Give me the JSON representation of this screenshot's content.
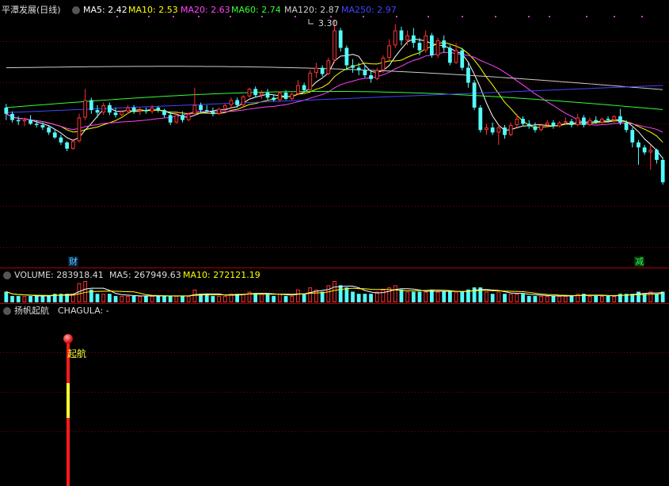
{
  "main_panel": {
    "title": "平潭发展(日线)",
    "ma": [
      {
        "label": "MA5: 2.42",
        "color": "#ffffff"
      },
      {
        "label": "MA10: 2.53",
        "color": "#ffff00"
      },
      {
        "label": "MA20: 2.63",
        "color": "#ff44ff"
      },
      {
        "label": "MA60: 2.74",
        "color": "#33ff33"
      },
      {
        "label": "MA120: 2.87",
        "color": "#cccccc"
      },
      {
        "label": "MA250: 2.97",
        "color": "#4444ff"
      }
    ],
    "high_marker": "3.30",
    "markers": [
      {
        "text": "财",
        "color": "#66ccff"
      },
      {
        "text": "减",
        "color": "#33ff66"
      }
    ]
  },
  "volume_panel": {
    "title": "VOLUME: 283918.41",
    "ma5": "MA5: 267949.63",
    "ma10": "MA10: 272121.19"
  },
  "indicator_panel": {
    "title": "扬帆起航",
    "chagula": "CHAGULA: -",
    "signal_label": "起航"
  },
  "colors": {
    "up": "#ff3232",
    "down": "#54fcfc",
    "grid": "#8b0000",
    "border": "#b00000"
  },
  "chart_data": {
    "type": "candlestick",
    "price_range": [
      1.9,
      3.35
    ],
    "volume_unit": "relative",
    "candles": [
      {
        "o": 2.6,
        "h": 2.63,
        "l": 2.5,
        "c": 2.55,
        "v": 0.5
      },
      {
        "o": 2.55,
        "h": 2.57,
        "l": 2.48,
        "c": 2.5,
        "v": 0.3
      },
      {
        "o": 2.5,
        "h": 2.53,
        "l": 2.46,
        "c": 2.49,
        "v": 0.3
      },
      {
        "o": 2.49,
        "h": 2.52,
        "l": 2.45,
        "c": 2.5,
        "v": 0.3
      },
      {
        "o": 2.5,
        "h": 2.54,
        "l": 2.46,
        "c": 2.47,
        "v": 0.3
      },
      {
        "o": 2.47,
        "h": 2.5,
        "l": 2.44,
        "c": 2.46,
        "v": 0.3
      },
      {
        "o": 2.46,
        "h": 2.48,
        "l": 2.42,
        "c": 2.44,
        "v": 0.3
      },
      {
        "o": 2.44,
        "h": 2.46,
        "l": 2.38,
        "c": 2.4,
        "v": 0.3
      },
      {
        "o": 2.4,
        "h": 2.42,
        "l": 2.35,
        "c": 2.36,
        "v": 0.4
      },
      {
        "o": 2.36,
        "h": 2.38,
        "l": 2.3,
        "c": 2.32,
        "v": 0.4
      },
      {
        "o": 2.32,
        "h": 2.33,
        "l": 2.25,
        "c": 2.27,
        "v": 0.4
      },
      {
        "o": 2.27,
        "h": 2.35,
        "l": 2.26,
        "c": 2.33,
        "v": 0.4
      },
      {
        "o": 2.33,
        "h": 2.55,
        "l": 2.32,
        "c": 2.52,
        "v": 0.9
      },
      {
        "o": 2.52,
        "h": 2.75,
        "l": 2.5,
        "c": 2.66,
        "v": 1.0
      },
      {
        "o": 2.66,
        "h": 2.68,
        "l": 2.55,
        "c": 2.58,
        "v": 0.6
      },
      {
        "o": 2.58,
        "h": 2.62,
        "l": 2.52,
        "c": 2.56,
        "v": 0.4
      },
      {
        "o": 2.56,
        "h": 2.64,
        "l": 2.54,
        "c": 2.62,
        "v": 0.4
      },
      {
        "o": 2.62,
        "h": 2.64,
        "l": 2.54,
        "c": 2.56,
        "v": 0.4
      },
      {
        "o": 2.56,
        "h": 2.6,
        "l": 2.52,
        "c": 2.54,
        "v": 0.3
      },
      {
        "o": 2.54,
        "h": 2.58,
        "l": 2.53,
        "c": 2.57,
        "v": 0.3
      },
      {
        "o": 2.57,
        "h": 2.62,
        "l": 2.55,
        "c": 2.6,
        "v": 0.3
      },
      {
        "o": 2.6,
        "h": 2.62,
        "l": 2.55,
        "c": 2.57,
        "v": 0.3
      },
      {
        "o": 2.57,
        "h": 2.6,
        "l": 2.54,
        "c": 2.58,
        "v": 0.3
      },
      {
        "o": 2.58,
        "h": 2.6,
        "l": 2.55,
        "c": 2.57,
        "v": 0.3
      },
      {
        "o": 2.57,
        "h": 2.62,
        "l": 2.55,
        "c": 2.6,
        "v": 0.3
      },
      {
        "o": 2.6,
        "h": 2.61,
        "l": 2.56,
        "c": 2.58,
        "v": 0.3
      },
      {
        "o": 2.58,
        "h": 2.59,
        "l": 2.52,
        "c": 2.54,
        "v": 0.3
      },
      {
        "o": 2.54,
        "h": 2.57,
        "l": 2.46,
        "c": 2.48,
        "v": 0.3
      },
      {
        "o": 2.48,
        "h": 2.56,
        "l": 2.47,
        "c": 2.54,
        "v": 0.3
      },
      {
        "o": 2.54,
        "h": 2.57,
        "l": 2.48,
        "c": 2.5,
        "v": 0.3
      },
      {
        "o": 2.5,
        "h": 2.56,
        "l": 2.49,
        "c": 2.55,
        "v": 0.3
      },
      {
        "o": 2.55,
        "h": 2.76,
        "l": 2.54,
        "c": 2.62,
        "v": 0.6
      },
      {
        "o": 2.62,
        "h": 2.64,
        "l": 2.55,
        "c": 2.58,
        "v": 0.4
      },
      {
        "o": 2.58,
        "h": 2.62,
        "l": 2.55,
        "c": 2.57,
        "v": 0.4
      },
      {
        "o": 2.57,
        "h": 2.6,
        "l": 2.53,
        "c": 2.55,
        "v": 0.3
      },
      {
        "o": 2.55,
        "h": 2.6,
        "l": 2.54,
        "c": 2.59,
        "v": 0.3
      },
      {
        "o": 2.59,
        "h": 2.63,
        "l": 2.57,
        "c": 2.62,
        "v": 0.3
      },
      {
        "o": 2.62,
        "h": 2.68,
        "l": 2.6,
        "c": 2.66,
        "v": 0.4
      },
      {
        "o": 2.66,
        "h": 2.68,
        "l": 2.6,
        "c": 2.62,
        "v": 0.4
      },
      {
        "o": 2.62,
        "h": 2.7,
        "l": 2.61,
        "c": 2.69,
        "v": 0.4
      },
      {
        "o": 2.69,
        "h": 2.76,
        "l": 2.68,
        "c": 2.75,
        "v": 0.5
      },
      {
        "o": 2.75,
        "h": 2.77,
        "l": 2.68,
        "c": 2.7,
        "v": 0.4
      },
      {
        "o": 2.7,
        "h": 2.74,
        "l": 2.67,
        "c": 2.72,
        "v": 0.4
      },
      {
        "o": 2.72,
        "h": 2.75,
        "l": 2.66,
        "c": 2.68,
        "v": 0.4
      },
      {
        "o": 2.68,
        "h": 2.7,
        "l": 2.65,
        "c": 2.66,
        "v": 0.3
      },
      {
        "o": 2.66,
        "h": 2.73,
        "l": 2.65,
        "c": 2.72,
        "v": 0.4
      },
      {
        "o": 2.72,
        "h": 2.74,
        "l": 2.66,
        "c": 2.67,
        "v": 0.3
      },
      {
        "o": 2.67,
        "h": 2.72,
        "l": 2.66,
        "c": 2.71,
        "v": 0.3
      },
      {
        "o": 2.71,
        "h": 2.82,
        "l": 2.7,
        "c": 2.78,
        "v": 0.6
      },
      {
        "o": 2.78,
        "h": 2.8,
        "l": 2.72,
        "c": 2.74,
        "v": 0.4
      },
      {
        "o": 2.74,
        "h": 2.9,
        "l": 2.73,
        "c": 2.88,
        "v": 0.7
      },
      {
        "o": 2.88,
        "h": 2.96,
        "l": 2.84,
        "c": 2.92,
        "v": 0.6
      },
      {
        "o": 2.92,
        "h": 2.94,
        "l": 2.85,
        "c": 2.87,
        "v": 0.5
      },
      {
        "o": 2.87,
        "h": 3.0,
        "l": 2.86,
        "c": 2.98,
        "v": 0.8
      },
      {
        "o": 2.98,
        "h": 3.3,
        "l": 2.96,
        "c": 3.22,
        "v": 1.0
      },
      {
        "o": 3.22,
        "h": 3.24,
        "l": 3.05,
        "c": 3.08,
        "v": 0.8
      },
      {
        "o": 3.08,
        "h": 3.1,
        "l": 2.9,
        "c": 2.94,
        "v": 0.7
      },
      {
        "o": 2.94,
        "h": 2.99,
        "l": 2.88,
        "c": 2.92,
        "v": 0.5
      },
      {
        "o": 2.92,
        "h": 2.96,
        "l": 2.86,
        "c": 2.9,
        "v": 0.4
      },
      {
        "o": 2.9,
        "h": 2.94,
        "l": 2.84,
        "c": 2.86,
        "v": 0.4
      },
      {
        "o": 2.86,
        "h": 2.9,
        "l": 2.8,
        "c": 2.83,
        "v": 0.4
      },
      {
        "o": 2.83,
        "h": 2.92,
        "l": 2.82,
        "c": 2.9,
        "v": 0.5
      },
      {
        "o": 2.9,
        "h": 3.02,
        "l": 2.88,
        "c": 3.0,
        "v": 0.6
      },
      {
        "o": 3.0,
        "h": 3.15,
        "l": 2.98,
        "c": 3.1,
        "v": 0.7
      },
      {
        "o": 3.1,
        "h": 3.27,
        "l": 3.08,
        "c": 3.22,
        "v": 0.8
      },
      {
        "o": 3.22,
        "h": 3.25,
        "l": 3.1,
        "c": 3.14,
        "v": 0.6
      },
      {
        "o": 3.14,
        "h": 3.22,
        "l": 3.1,
        "c": 3.18,
        "v": 0.5
      },
      {
        "o": 3.18,
        "h": 3.24,
        "l": 3.08,
        "c": 3.12,
        "v": 0.5
      },
      {
        "o": 3.12,
        "h": 3.16,
        "l": 3.02,
        "c": 3.06,
        "v": 0.5
      },
      {
        "o": 3.06,
        "h": 3.22,
        "l": 3.04,
        "c": 3.18,
        "v": 0.5
      },
      {
        "o": 3.18,
        "h": 3.2,
        "l": 3.0,
        "c": 3.02,
        "v": 0.6
      },
      {
        "o": 3.02,
        "h": 3.16,
        "l": 3.0,
        "c": 3.14,
        "v": 0.5
      },
      {
        "o": 3.14,
        "h": 3.18,
        "l": 3.04,
        "c": 3.08,
        "v": 0.5
      },
      {
        "o": 3.08,
        "h": 3.1,
        "l": 2.94,
        "c": 2.96,
        "v": 0.5
      },
      {
        "o": 2.96,
        "h": 3.12,
        "l": 2.95,
        "c": 3.06,
        "v": 0.5
      },
      {
        "o": 3.06,
        "h": 3.08,
        "l": 2.9,
        "c": 2.92,
        "v": 0.5
      },
      {
        "o": 2.92,
        "h": 2.96,
        "l": 2.76,
        "c": 2.8,
        "v": 0.6
      },
      {
        "o": 2.8,
        "h": 2.82,
        "l": 2.58,
        "c": 2.6,
        "v": 0.7
      },
      {
        "o": 2.6,
        "h": 2.62,
        "l": 2.4,
        "c": 2.42,
        "v": 0.7
      },
      {
        "o": 2.42,
        "h": 2.47,
        "l": 2.38,
        "c": 2.44,
        "v": 0.5
      },
      {
        "o": 2.44,
        "h": 2.48,
        "l": 2.38,
        "c": 2.4,
        "v": 0.4
      },
      {
        "o": 2.4,
        "h": 2.46,
        "l": 2.3,
        "c": 2.44,
        "v": 0.5
      },
      {
        "o": 2.44,
        "h": 2.46,
        "l": 2.35,
        "c": 2.38,
        "v": 0.4
      },
      {
        "o": 2.38,
        "h": 2.48,
        "l": 2.37,
        "c": 2.46,
        "v": 0.4
      },
      {
        "o": 2.46,
        "h": 2.55,
        "l": 2.44,
        "c": 2.51,
        "v": 0.4
      },
      {
        "o": 2.51,
        "h": 2.53,
        "l": 2.45,
        "c": 2.47,
        "v": 0.4
      },
      {
        "o": 2.47,
        "h": 2.5,
        "l": 2.43,
        "c": 2.45,
        "v": 0.3
      },
      {
        "o": 2.45,
        "h": 2.48,
        "l": 2.4,
        "c": 2.42,
        "v": 0.3
      },
      {
        "o": 2.42,
        "h": 2.47,
        "l": 2.41,
        "c": 2.46,
        "v": 0.3
      },
      {
        "o": 2.46,
        "h": 2.5,
        "l": 2.44,
        "c": 2.48,
        "v": 0.3
      },
      {
        "o": 2.48,
        "h": 2.5,
        "l": 2.43,
        "c": 2.45,
        "v": 0.3
      },
      {
        "o": 2.45,
        "h": 2.49,
        "l": 2.44,
        "c": 2.48,
        "v": 0.3
      },
      {
        "o": 2.48,
        "h": 2.52,
        "l": 2.46,
        "c": 2.49,
        "v": 0.3
      },
      {
        "o": 2.49,
        "h": 2.51,
        "l": 2.44,
        "c": 2.46,
        "v": 0.3
      },
      {
        "o": 2.46,
        "h": 2.55,
        "l": 2.45,
        "c": 2.52,
        "v": 0.4
      },
      {
        "o": 2.52,
        "h": 2.54,
        "l": 2.44,
        "c": 2.46,
        "v": 0.4
      },
      {
        "o": 2.46,
        "h": 2.52,
        "l": 2.45,
        "c": 2.5,
        "v": 0.3
      },
      {
        "o": 2.5,
        "h": 2.53,
        "l": 2.47,
        "c": 2.48,
        "v": 0.3
      },
      {
        "o": 2.48,
        "h": 2.52,
        "l": 2.47,
        "c": 2.51,
        "v": 0.3
      },
      {
        "o": 2.51,
        "h": 2.53,
        "l": 2.48,
        "c": 2.5,
        "v": 0.3
      },
      {
        "o": 2.5,
        "h": 2.54,
        "l": 2.48,
        "c": 2.53,
        "v": 0.3
      },
      {
        "o": 2.53,
        "h": 2.59,
        "l": 2.46,
        "c": 2.48,
        "v": 0.4
      },
      {
        "o": 2.48,
        "h": 2.5,
        "l": 2.4,
        "c": 2.42,
        "v": 0.4
      },
      {
        "o": 2.42,
        "h": 2.44,
        "l": 2.28,
        "c": 2.32,
        "v": 0.4
      },
      {
        "o": 2.32,
        "h": 2.34,
        "l": 2.14,
        "c": 2.28,
        "v": 0.5
      },
      {
        "o": 2.28,
        "h": 2.3,
        "l": 2.22,
        "c": 2.24,
        "v": 0.4
      },
      {
        "o": 2.24,
        "h": 2.3,
        "l": 2.1,
        "c": 2.26,
        "v": 0.5
      },
      {
        "o": 2.26,
        "h": 2.27,
        "l": 2.15,
        "c": 2.18,
        "v": 0.4
      },
      {
        "o": 2.18,
        "h": 2.2,
        "l": 1.98,
        "c": 2.0,
        "v": 0.5
      }
    ]
  }
}
